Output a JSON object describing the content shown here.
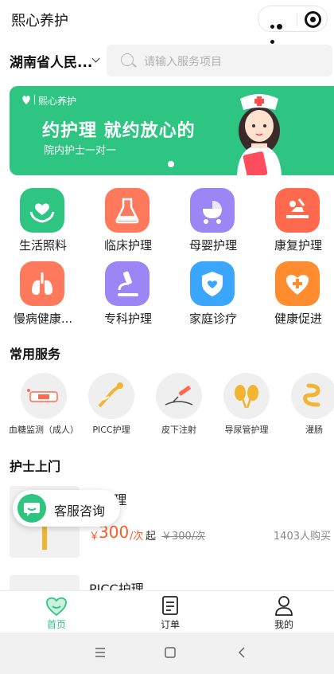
{
  "titlebar": {
    "title": "熙心养护"
  },
  "location": {
    "label": "湖南省人民..."
  },
  "search": {
    "placeholder": "请输入服务项目"
  },
  "banner": {
    "brand": "熙心养护",
    "headline": "约护理 就约放心的",
    "subline": "院内护士一对一"
  },
  "categories": [
    {
      "label": "生活照料",
      "color": "#2ec482",
      "icon": "hands-heart-icon"
    },
    {
      "label": "临床护理",
      "color": "#ff7a5c",
      "icon": "flask-icon"
    },
    {
      "label": "母婴护理",
      "color": "#9a86f4",
      "icon": "stroller-icon"
    },
    {
      "label": "康复护理",
      "color": "#ff6a4e",
      "icon": "massage-icon"
    },
    {
      "label": "慢病健康...",
      "color": "#ff7a5c",
      "icon": "lungs-icon"
    },
    {
      "label": "专科护理",
      "color": "#9a86f4",
      "icon": "microscope-icon"
    },
    {
      "label": "家庭诊疗",
      "color": "#3aa6ff",
      "icon": "shield-heart-icon"
    },
    {
      "label": "健康促进",
      "color": "#ff8c2e",
      "icon": "plus-heart-icon"
    }
  ],
  "common_services": {
    "title": "常用服务",
    "items": [
      {
        "label": "血糖监测（成人）",
        "icon": "glucose-meter-icon"
      },
      {
        "label": "PICC护理",
        "icon": "picc-icon"
      },
      {
        "label": "皮下注射",
        "icon": "syringe-icon"
      },
      {
        "label": "导尿管护理",
        "icon": "kidney-icon"
      },
      {
        "label": "灌肠",
        "icon": "intestine-icon"
      }
    ]
  },
  "home_visit": {
    "title": "护士上门",
    "items": [
      {
        "name": "...护理",
        "price_symbol": "￥",
        "price": "300",
        "unit": "/次",
        "from": "起",
        "original": "￥300/次",
        "sold": "1403人购买"
      },
      {
        "name": "PICC护理"
      }
    ]
  },
  "chip": {
    "label": "客服咨询"
  },
  "tabs": [
    {
      "label": "首页",
      "icon": "home-heart-icon",
      "active": true
    },
    {
      "label": "订单",
      "icon": "order-icon",
      "active": false
    },
    {
      "label": "我的",
      "icon": "profile-icon",
      "active": false
    }
  ],
  "colors": {
    "brand": "#2ec482",
    "price": "#ff5a26"
  }
}
